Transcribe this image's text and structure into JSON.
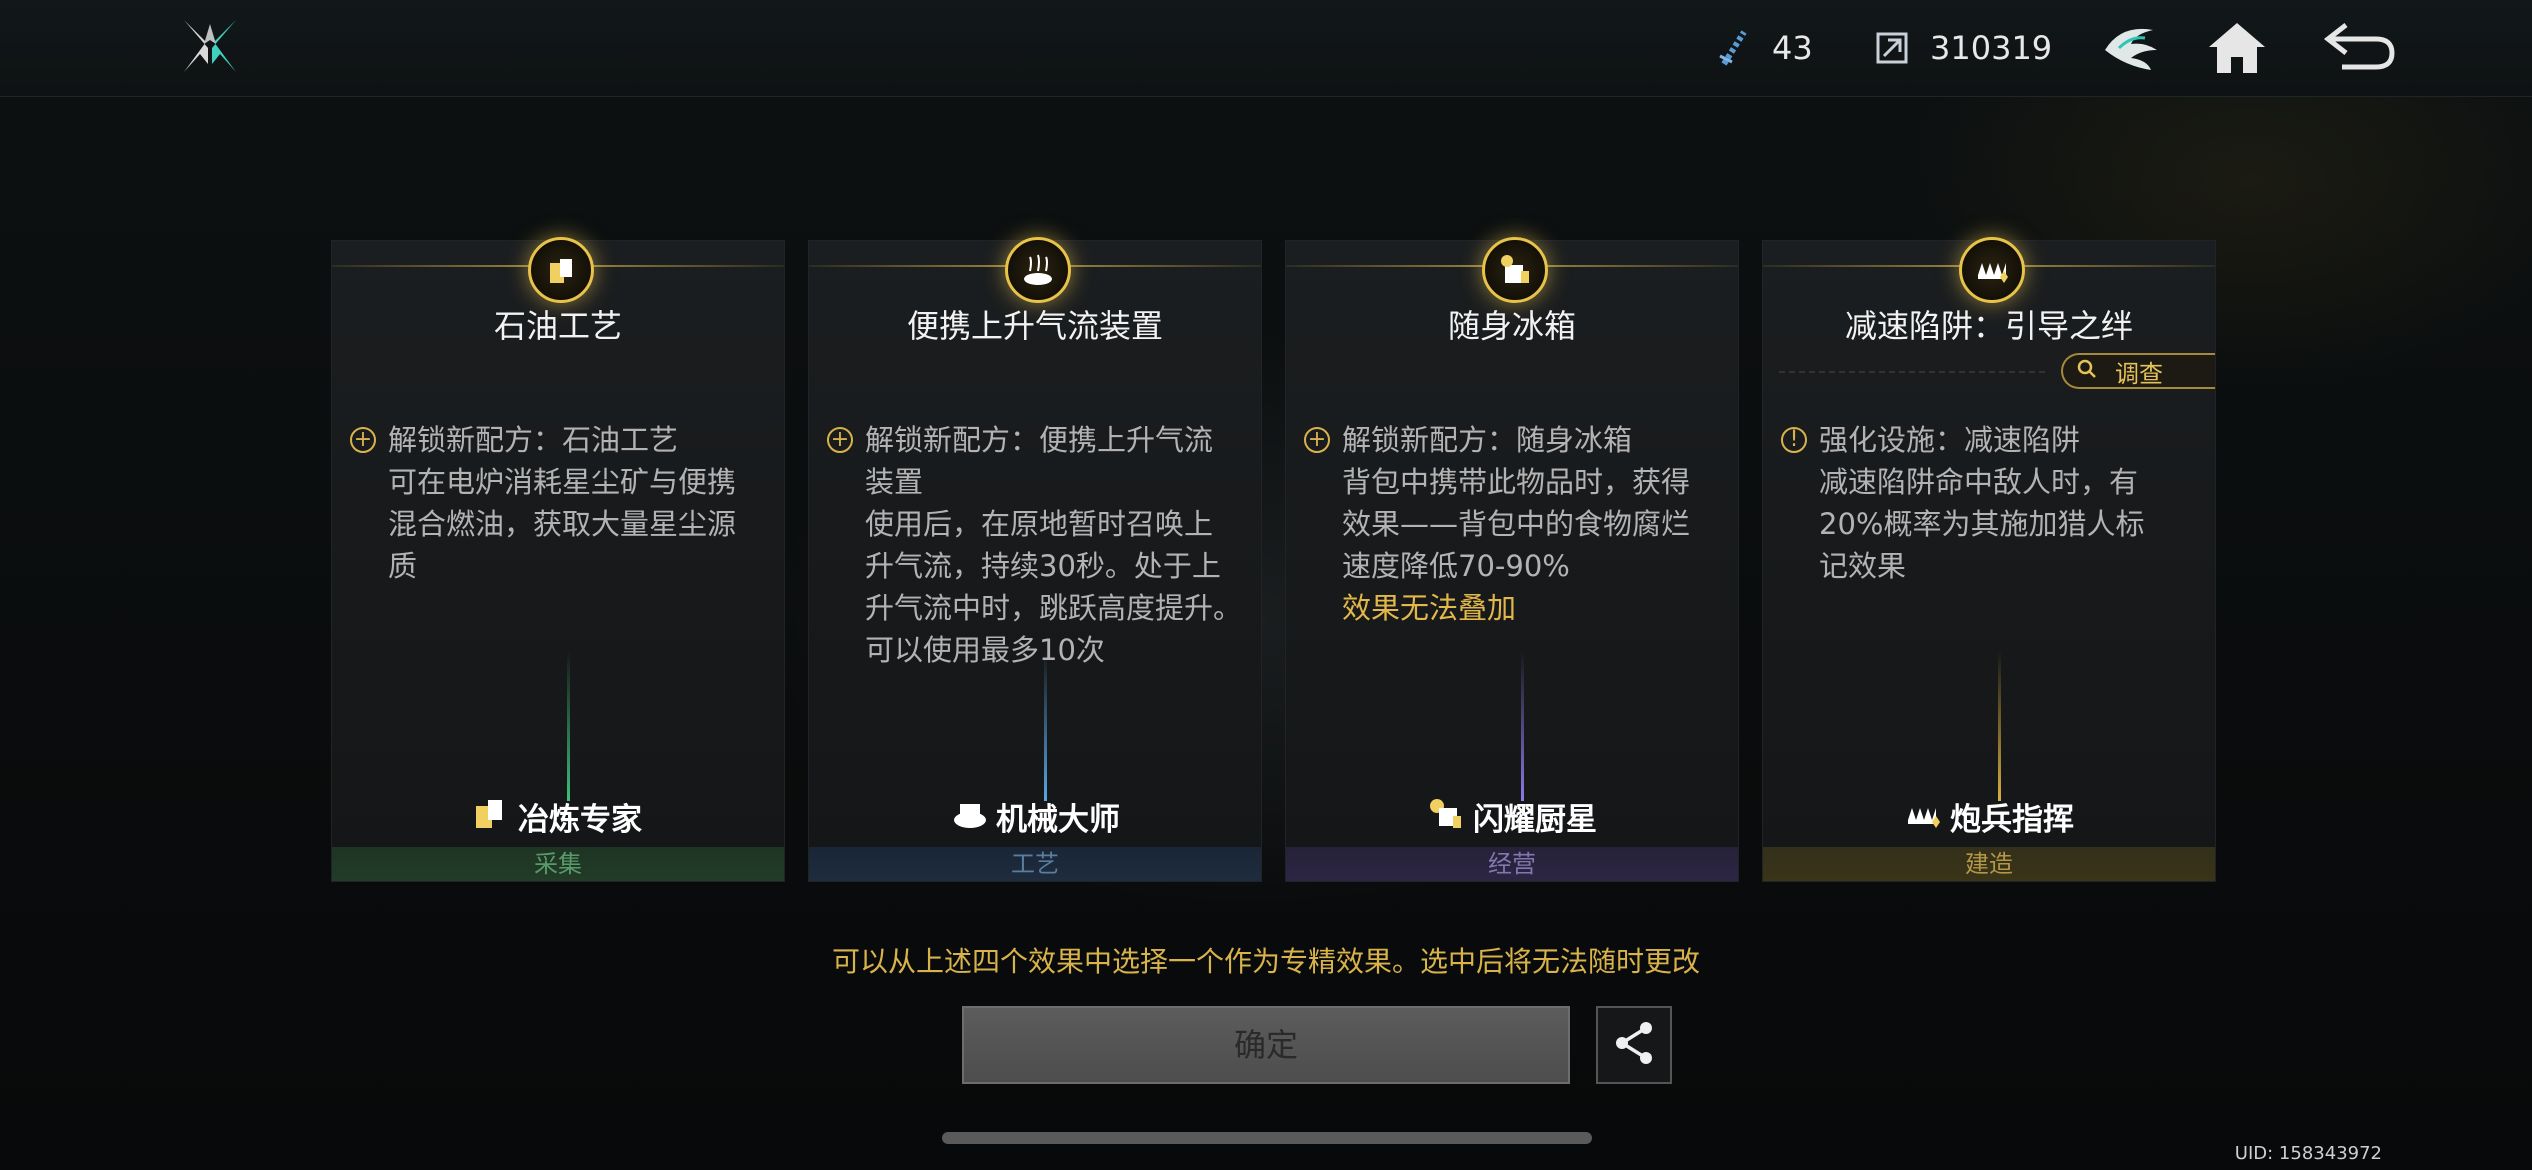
{
  "topbar": {
    "resource1": {
      "icon": "crystal-icon",
      "value": "43"
    },
    "resource2": {
      "icon": "currency-icon",
      "value": "310319"
    }
  },
  "cards": [
    {
      "title": "石油工艺",
      "lines": [
        "解锁新配方：石油工艺",
        "可在电炉消耗星尘矿与便携",
        "混合燃油，获取大量星尘源",
        "质"
      ],
      "warning": "",
      "profession": "冶炼专家",
      "category": "采集",
      "beam_color": "#3fbf7a",
      "cat_color": "#1e3a24",
      "cat_text_color": "#5a9a6a"
    },
    {
      "title": "便携上升气流装置",
      "lines": [
        "解锁新配方：便携上升气流",
        "装置",
        "使用后，在原地暂时召唤上",
        "升气流，持续30秒。处于上",
        "升气流中时，跳跃高度提升。",
        "可以使用最多10次"
      ],
      "warning": "",
      "profession": "机械大师",
      "category": "工艺",
      "beam_color": "#5aa6e6",
      "cat_color": "#1c2a3a",
      "cat_text_color": "#5a7ea0"
    },
    {
      "title": "随身冰箱",
      "lines": [
        "解锁新配方：随身冰箱",
        "背包中携带此物品时，获得",
        "效果——背包中的食物腐烂",
        "速度降低70-90%"
      ],
      "warning": "效果无法叠加",
      "profession": "闪耀厨星",
      "category": "经营",
      "beam_color": "#8c7ae6",
      "cat_color": "#2a2540",
      "cat_text_color": "#8676b0"
    },
    {
      "title": "减速陷阱：引导之绊",
      "lines": [
        "强化设施：减速陷阱",
        "减速陷阱命中敌人时，有",
        "20%概率为其施加猎人标",
        "记效果"
      ],
      "warning": "",
      "profession": "炮兵指挥",
      "category": "建造",
      "beam_color": "#d8b040",
      "cat_color": "#3a3218",
      "cat_text_color": "#b39646",
      "investigate_label": "调查"
    }
  ],
  "hint": "可以从上述四个效果中选择一个作为专精效果。选中后将无法随时更改",
  "confirm_label": "确定",
  "uid": "UID: 158343972"
}
